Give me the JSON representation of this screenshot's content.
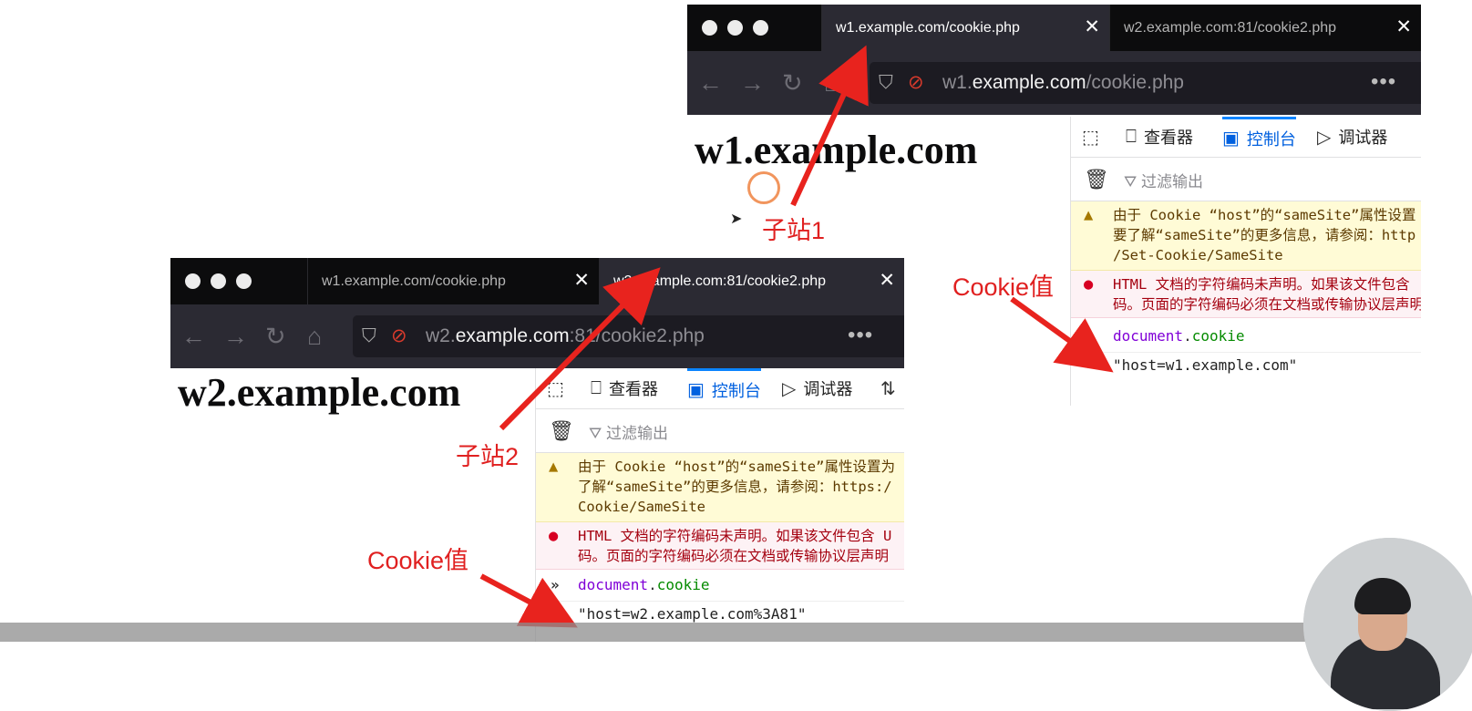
{
  "window_w1": {
    "tabs": [
      {
        "title": "w1.example.com/cookie.php",
        "active": true
      },
      {
        "title": "w2.example.com:81/cookie2.php",
        "active": false
      }
    ],
    "url": {
      "prefix": "w1.",
      "host": "example.com",
      "path": "/cookie.php"
    },
    "page_heading": "w1.example.com"
  },
  "window_w2": {
    "tabs": [
      {
        "title": "w1.example.com/cookie.php",
        "active": false
      },
      {
        "title": "w2.example.com:81/cookie2.php",
        "active": true
      }
    ],
    "url": {
      "prefix": "w2.",
      "host": "example.com",
      "path": ":81/cookie2.php"
    },
    "page_heading": "w2.example.com"
  },
  "nav_icons": [
    "back-arrow-icon",
    "forward-arrow-icon",
    "reload-icon",
    "home-icon",
    "shield-icon",
    "blocked-permission-icon",
    "more-menu-icon"
  ],
  "devtools": {
    "tabs": [
      "查看器",
      "控制台",
      "调试器"
    ],
    "active_tab": "控制台",
    "filter_placeholder": "过滤输出",
    "w1": {
      "warning_lines": [
        "由于 Cookie “host”的“sameSite”属性设置",
        "要了解“sameSite”的更多信息，请参阅：http",
        "/Set-Cookie/SameSite"
      ],
      "error_lines": [
        "HTML 文档的字符编码未声明。如果该文件包含",
        "码。页面的字符编码必须在文档或传输协议层声明"
      ],
      "command_object": "document",
      "command_property": "cookie",
      "result": "\"host=w1.example.com\""
    },
    "w2": {
      "warning_lines": [
        "由于 Cookie “host”的“sameSite”属性设置为",
        "了解“sameSite”的更多信息，请参阅：https:/",
        "Cookie/SameSite"
      ],
      "error_lines": [
        "HTML 文档的字符编码未声明。如果该文件包含 U",
        "码。页面的字符编码必须在文档或传输协议层声明"
      ],
      "command_object": "document",
      "command_property": "cookie",
      "result": "\"host=w2.example.com%3A81\""
    }
  },
  "annotations": {
    "subsite1": "子站1",
    "subsite2": "子站2",
    "cookie_value_1": "Cookie值",
    "cookie_value_2": "Cookie值",
    "color": "#e02020"
  },
  "colors": {
    "tab_bar": "#0c0c0d",
    "toolbar": "#2b2a33",
    "devtools_accent": "#0a84ff",
    "warning_bg": "#fffbd6",
    "error_bg": "#fdf2f5"
  }
}
